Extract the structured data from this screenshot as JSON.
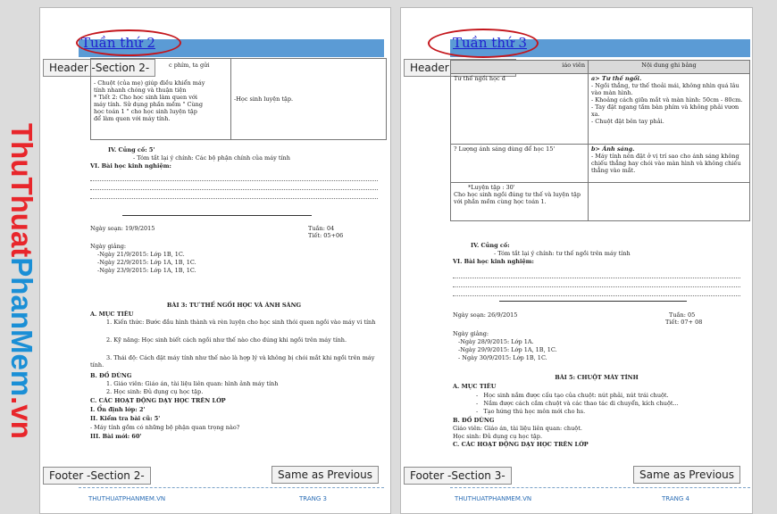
{
  "watermark": {
    "part1": "ThuThuat",
    "part2": "PhanMem",
    "part3": ".vn",
    "color1": "#e8262b",
    "color2": "#1a8fd6"
  },
  "page1": {
    "tuan": "Tuần thứ 2",
    "header_tag": "Header -Section 2-",
    "footer_tag": "Footer -Section 2-",
    "footer_left": "THUTHUATPHANMEM.VN",
    "footer_right": "TRANG 3",
    "table_left_lines": [
      "c phím, ta gửi",
      "- Chuột (của mẹ) giúp điều khiển máy",
      "tính nhanh chóng và thuận tiện",
      "* Tiết 2: Cho học sinh làm quen với",
      "máy tính. Sử dụng phần mềm \" Cùng",
      "học toán 1 \" cho học sinh luyện tập",
      "để làm quen với máy tính."
    ],
    "table_right": "-Học sinh luyện tập.",
    "cung_co_title": "IV. Củng cố: 5'",
    "cung_co_text": "- Tóm tắt lại ý chính: Các bộ phận chính của máy tính",
    "bai_hoc": "VI. Bài học kinh nghiệm:",
    "ngay_soan": "Ngày soạn: 19/9/2015",
    "tuan_so": "Tuần: 04",
    "tiet": "Tiết: 05+06",
    "ngay_giang": "Ngày giảng:",
    "ngay_list": [
      "-Ngày 21/9/2015: Lớp 1B, 1C.",
      "-Ngày 22/9/2015: Lớp 1A, 1B, 1C.",
      "-Ngày 23/9/2015: Lớp 1A, 1B, 1C."
    ],
    "bai_title": "BÀI 3: TƯ THẾ NGỒI HỌC VÀ ÁNH SÁNG",
    "muc_tieu": "A. MỤC TIÊU",
    "kien_thuc": "1. Kiến thức: Bước đầu hình thành và rèn luyện cho học sinh thói quen ngồi vào máy vi tính",
    "ky_nang": "2. Kỹ năng: Học sinh biết cách ngồi như thế nào cho đúng khi ngồi trên máy tính.",
    "thai_do": "3. Thái độ: Cách đặt máy tính như thế nào là hợp lý và không bị chói mắt khi ngồi trên máy tính.",
    "do_dung": "B. ĐỒ DÙNG",
    "gv": "1. Giáo viên: Giáo án, tài liệu liên quan: hình ảnh máy tính",
    "hs": "2. Học sinh: Đủ dụng cụ học tập.",
    "hoat_dong": "C. CÁC HOẠT ĐỘNG DẠY HỌC TRÊN LỚP",
    "on_dinh": "I. Ổn định lớp: 2'",
    "kiem_tra": "II. Kiểm tra bài cũ: 5'",
    "kiem_tra_q": "- Máy tính gồm có những bộ phận quan trọng nào?",
    "bai_moi": "III. Bài mới: 60'"
  },
  "page2": {
    "tuan": "Tuần thứ 3",
    "header_tag": "Header -Section 3-",
    "footer_tag": "Footer -Section 3-",
    "same_as_previous": "Same as Previous",
    "footer_left": "THUTHUATPHANMEM.VN",
    "footer_right": "TRANG 4",
    "th_left": "iáo viên",
    "th_right": "Nội dung ghi bảng",
    "row1_left": "Tư thế ngồi học đ",
    "row1_right": [
      "a> Tư thế ngồi.",
      "- Ngồi thẳng, tư thế thoải mái, không nhìn quá lâu vào màn hình.",
      "- Khoảng cách giữa mắt và màn hình: 50cm - 80cm.",
      "- Tay đặt ngang tầm bàn phím và không phải vươn xa.",
      "- Chuột đặt bên tay phải."
    ],
    "row2_left": "? Lượng ánh sáng dùng để học 15'",
    "row2_right": [
      "b> Ánh sáng.",
      "- Máy tính nên đặt ở vị trí sao cho ánh sáng không chiếu thẳng hay chói vào màn hình và không chiếu thẳng vào mắt."
    ],
    "row3_left": [
      "*Luyện tập : 30'",
      "Cho học sinh ngồi đúng tư thế và luyện tập với phần mềm cùng học toán 1."
    ],
    "cung_co_title": "IV. Củng cố:",
    "cung_co_text": "- Tóm tắt lại ý chính: tư thế ngồi trên máy tính",
    "bai_hoc": "VI. Bài học kinh nghiệm:",
    "ngay_soan": "Ngày soạn: 26/9/2015",
    "tuan_so": "Tuần: 05",
    "tiet": "Tiết: 07+ 08",
    "ngay_giang": "Ngày giảng:",
    "ngay_list": [
      "-Ngày 28/9/2015: Lớp 1A.",
      "-Ngày 29/9/2015: Lớp 1A, 1B, 1C.",
      "- Ngày 30/9/2015: Lớp 1B, 1C."
    ],
    "bai_title": "BÀI 5: CHUỘT MÁY TÍNH",
    "muc_tieu": "A. MỤC TIÊU",
    "mt_list": [
      "Học sinh nắm được cấu tạo của chuột: nút phải, nút trái chuột.",
      "Nắm được cách cầm chuột và các thao tác di chuyển, kích chuột...",
      "Tạo hứng thú học môn mới cho hs."
    ],
    "do_dung": "B. ĐỒ DÙNG",
    "gv": "Giáo viên: Giáo án, tài liệu liên quan: chuột.",
    "hs": "Học sinh: Đủ dụng cụ học tập.",
    "hoat_dong": "C. CÁC HOẠT ĐỘNG DẠY HỌC TRÊN LỚP"
  },
  "colors": {
    "header_band": "#5b9bd5",
    "ellipse": "#c4161c",
    "link_blue": "#1f1fd0"
  }
}
